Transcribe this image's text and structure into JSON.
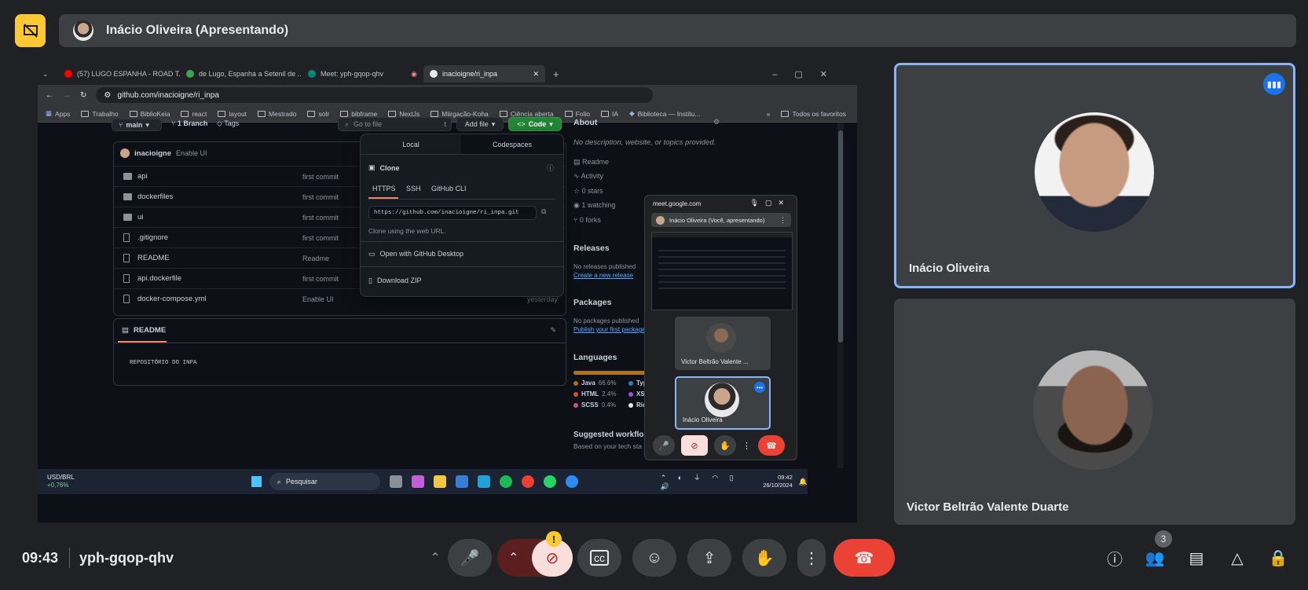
{
  "presenter": {
    "name": "Inácio Oliveira (Apresentando)"
  },
  "browser": {
    "tabs": [
      {
        "label": "(57) LUGO ESPANHA - ROAD T...",
        "icon": "youtube-icon"
      },
      {
        "label": "de Lugo, Espanha a Setenil de ...",
        "icon": "maps-icon"
      },
      {
        "label": "Meet: yph-gqop-qhv",
        "icon": "meet-icon"
      },
      {
        "label": "inacioigne/ri_inpa",
        "icon": "github-icon"
      }
    ],
    "new_tab": "+",
    "url": "github.com/inacioigne/ri_inpa",
    "bookmarks": [
      "Apps",
      "Trabalho",
      "BiblioKeia",
      "react",
      "layout",
      "Mestrado",
      "solr",
      "bibframe",
      "NextJs",
      "Miirgação-Koha",
      "Ciência aberta",
      "Folio",
      "IA",
      "Biblioteca — Institu..."
    ],
    "bookmarks_more": "»",
    "all_bookmarks": "Todos os favoritos"
  },
  "repo": {
    "branch": "main",
    "branches": "1 Branch",
    "tags": "Tags",
    "goto_placeholder": "Go to file",
    "goto_key": "t",
    "add_file": "Add file",
    "code": "Code",
    "commit_author": "inacioigne",
    "commit_msg": "Enable UI",
    "files": [
      {
        "name": "api",
        "type": "folder",
        "msg": "first commit"
      },
      {
        "name": "dockerfiles",
        "type": "folder",
        "msg": "first commit"
      },
      {
        "name": "ui",
        "type": "folder",
        "msg": "first commit"
      },
      {
        "name": ".gitignore",
        "type": "file",
        "msg": "first commit"
      },
      {
        "name": "README",
        "type": "file",
        "msg": "Readme"
      },
      {
        "name": "api.dockerfile",
        "type": "file",
        "msg": "first commit"
      },
      {
        "name": "docker-compose.yml",
        "type": "file",
        "msg": "Enable UI"
      }
    ],
    "last_time": "yesterday",
    "readme_tab": "README",
    "readme_body": "REPOSITÓRIO DO INPA"
  },
  "clone": {
    "tab_local": "Local",
    "tab_codespaces": "Codespaces",
    "title": "Clone",
    "protocols": [
      "HTTPS",
      "SSH",
      "GitHub CLI"
    ],
    "url": "https://github.com/inacioigne/ri_inpa.git",
    "hint": "Clone using the web URL.",
    "open_desktop": "Open with GitHub Desktop",
    "download_zip": "Download ZIP"
  },
  "about": {
    "title": "About",
    "desc": "No description, website, or topics provided.",
    "items": [
      "Readme",
      "Activity",
      "0 stars",
      "1 watching",
      "0 forks"
    ],
    "releases_title": "Releases",
    "releases_text": "No releases published",
    "releases_link": "Create a new release",
    "packages_title": "Packages",
    "packages_text": "No packages published",
    "packages_link": "Publish your first package",
    "languages_title": "Languages",
    "languages": [
      {
        "name": "Java",
        "pct": "66.6%",
        "color": "#b07219"
      },
      {
        "name": "HTML",
        "pct": "2.4%",
        "color": "#e34c26"
      },
      {
        "name": "SCSS",
        "pct": "0.4%",
        "color": "#c6538c"
      }
    ],
    "languages_right": [
      {
        "name": "Typ",
        "color": "#3178c6"
      },
      {
        "name": "XS",
        "color": "#a84bd6"
      },
      {
        "name": "Rid",
        "color": "#e8eaed"
      }
    ],
    "workflows_title": "Suggested workflo",
    "workflows_text": "Based on your tech sta"
  },
  "minimeet": {
    "domain": "meet.google.com",
    "presenting": "Inácio Oliveira (Você, apresentando)",
    "tile_a": "Victor Beltrão Valente ...",
    "tile_b": "Inácio Oliveira"
  },
  "taskbar": {
    "currency": "USD/BRL",
    "change": "+0,76%",
    "search": "Pesquisar",
    "time": "09:42",
    "date": "26/10/2024"
  },
  "participants": [
    {
      "name": "Inácio Oliveira"
    },
    {
      "name": "Victor Beltrão Valente Duarte"
    }
  ],
  "meeting": {
    "time": "09:43",
    "code": "yph-gqop-qhv",
    "people_count": "3",
    "alert": "!"
  },
  "colors": {
    "accent": "#8ab4f8",
    "end_call": "#ea4335",
    "cam_off": "#f9dedc",
    "present_badge": "#fcc934"
  }
}
